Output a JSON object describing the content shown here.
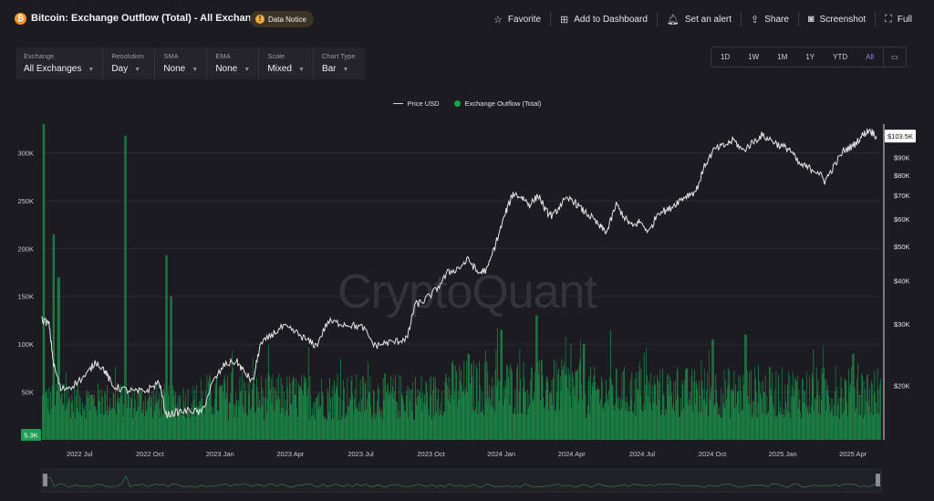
{
  "header": {
    "coin_symbol": "₿",
    "title": "Bitcoin: Exchange Outflow (Total) - All Exchanges",
    "notice_icon": "!",
    "notice_label": "Data Notice"
  },
  "actions": [
    {
      "icon": "star-icon",
      "glyph": "☆",
      "label": "Favorite"
    },
    {
      "icon": "dashboard-add-icon",
      "glyph": "⊞",
      "label": "Add to Dashboard"
    },
    {
      "icon": "bell-icon",
      "glyph": "🔔︎",
      "label": "Set an alert"
    },
    {
      "icon": "share-icon",
      "glyph": "⇪",
      "label": "Share"
    },
    {
      "icon": "camera-icon",
      "glyph": "◙",
      "label": "Screenshot"
    },
    {
      "icon": "fullscreen-icon",
      "glyph": "⛶",
      "label": "Full"
    }
  ],
  "controls": [
    {
      "label": "Exchange",
      "value": "All Exchanges"
    },
    {
      "label": "Resolution",
      "value": "Day"
    },
    {
      "label": "SMA",
      "value": "None"
    },
    {
      "label": "EMA",
      "value": "None"
    },
    {
      "label": "Scale",
      "value": "Mixed"
    },
    {
      "label": "Chart Type",
      "value": "Bar"
    }
  ],
  "ranges": [
    "1D",
    "1W",
    "1M",
    "1Y",
    "YTD",
    "All"
  ],
  "active_range": "All",
  "watermark": "CryptoQuant",
  "chart_data": {
    "type": "bar",
    "legend": [
      "Price USD",
      "Exchange Outflow (Total)"
    ],
    "colors": {
      "price": "#e6e6e6",
      "outflow": "#17a34a",
      "outflow_fill": "#1f8a4c",
      "price_badge": "#ffffff",
      "outflow_badge": "#1f9d55"
    },
    "x_tick_labels": [
      "2022 Jul",
      "2022 Oct",
      "2023 Jan",
      "2023 Apr",
      "2023 Jul",
      "2023 Oct",
      "2024 Jan",
      "2024 Apr",
      "2024 Jul",
      "2024 Oct",
      "2025 Jan",
      "2025 Apr"
    ],
    "x_range_months": [
      0,
      35.8
    ],
    "x_tick_months": [
      1.6,
      4.6,
      7.6,
      10.6,
      13.6,
      16.6,
      19.6,
      22.6,
      25.6,
      28.6,
      31.6,
      34.6
    ],
    "left_axis": {
      "label": "Exchange Outflow",
      "ticks": [
        "50K",
        "100K",
        "150K",
        "200K",
        "250K",
        "300K"
      ],
      "tick_values": [
        50000,
        100000,
        150000,
        200000,
        250000,
        300000
      ],
      "range": [
        0,
        330000
      ]
    },
    "right_axis": {
      "label": "Price USD",
      "scale": "log",
      "ticks": [
        "$20K",
        "$30K",
        "$40K",
        "$50K",
        "$60K",
        "$70K",
        "$80K",
        "$90K"
      ],
      "tick_values": [
        20000,
        30000,
        40000,
        50000,
        60000,
        70000,
        80000,
        90000
      ],
      "range": [
        14000,
        112000
      ]
    },
    "last_price_label": "$103.5K",
    "last_outflow_label": "5.3K",
    "outflow_spikes": [
      {
        "month": 0.05,
        "value": 330000
      },
      {
        "month": 0.5,
        "value": 215000
      },
      {
        "month": 0.7,
        "value": 170000
      },
      {
        "month": 3.55,
        "value": 318000
      },
      {
        "month": 5.3,
        "value": 193000
      },
      {
        "month": 5.5,
        "value": 150000
      },
      {
        "month": 18.2,
        "value": 90000
      },
      {
        "month": 19.6,
        "value": 115000
      },
      {
        "month": 21.1,
        "value": 130000
      },
      {
        "month": 23.1,
        "value": 100000
      },
      {
        "month": 28.6,
        "value": 105000
      },
      {
        "month": 30.0,
        "value": 110000
      },
      {
        "month": 34.6,
        "value": 90000
      }
    ],
    "price_series": [
      {
        "month": 0.0,
        "price": 31000
      },
      {
        "month": 0.3,
        "price": 30000
      },
      {
        "month": 0.5,
        "price": 23000
      },
      {
        "month": 0.8,
        "price": 19500
      },
      {
        "month": 1.3,
        "price": 20000
      },
      {
        "month": 1.9,
        "price": 21500
      },
      {
        "month": 2.3,
        "price": 23500
      },
      {
        "month": 2.7,
        "price": 22000
      },
      {
        "month": 3.0,
        "price": 20000
      },
      {
        "month": 3.5,
        "price": 19500
      },
      {
        "month": 4.0,
        "price": 19200
      },
      {
        "month": 4.5,
        "price": 19400
      },
      {
        "month": 5.0,
        "price": 20500
      },
      {
        "month": 5.3,
        "price": 16500
      },
      {
        "month": 5.8,
        "price": 16800
      },
      {
        "month": 6.4,
        "price": 17000
      },
      {
        "month": 6.8,
        "price": 16700
      },
      {
        "month": 7.3,
        "price": 20500
      },
      {
        "month": 7.8,
        "price": 23000
      },
      {
        "month": 8.3,
        "price": 23500
      },
      {
        "month": 8.6,
        "price": 22000
      },
      {
        "month": 9.0,
        "price": 20500
      },
      {
        "month": 9.3,
        "price": 26000
      },
      {
        "month": 9.8,
        "price": 28000
      },
      {
        "month": 10.3,
        "price": 29500
      },
      {
        "month": 10.8,
        "price": 28500
      },
      {
        "month": 11.3,
        "price": 27000
      },
      {
        "month": 11.7,
        "price": 26000
      },
      {
        "month": 12.2,
        "price": 30500
      },
      {
        "month": 12.7,
        "price": 30200
      },
      {
        "month": 13.2,
        "price": 29800
      },
      {
        "month": 13.7,
        "price": 29300
      },
      {
        "month": 14.2,
        "price": 26000
      },
      {
        "month": 14.7,
        "price": 26500
      },
      {
        "month": 15.2,
        "price": 26800
      },
      {
        "month": 15.6,
        "price": 27500
      },
      {
        "month": 15.9,
        "price": 34000
      },
      {
        "month": 16.3,
        "price": 35000
      },
      {
        "month": 16.8,
        "price": 37500
      },
      {
        "month": 17.3,
        "price": 42000
      },
      {
        "month": 17.8,
        "price": 43500
      },
      {
        "month": 18.2,
        "price": 46000
      },
      {
        "month": 18.6,
        "price": 42000
      },
      {
        "month": 19.0,
        "price": 43000
      },
      {
        "month": 19.4,
        "price": 52000
      },
      {
        "month": 19.8,
        "price": 63000
      },
      {
        "month": 20.1,
        "price": 71000
      },
      {
        "month": 20.5,
        "price": 69000
      },
      {
        "month": 20.8,
        "price": 66000
      },
      {
        "month": 21.2,
        "price": 70000
      },
      {
        "month": 21.5,
        "price": 63000
      },
      {
        "month": 21.8,
        "price": 61000
      },
      {
        "month": 22.2,
        "price": 67000
      },
      {
        "month": 22.6,
        "price": 68500
      },
      {
        "month": 23.0,
        "price": 64000
      },
      {
        "month": 23.4,
        "price": 61000
      },
      {
        "month": 23.8,
        "price": 57000
      },
      {
        "month": 24.1,
        "price": 55000
      },
      {
        "month": 24.5,
        "price": 66000
      },
      {
        "month": 24.9,
        "price": 60000
      },
      {
        "month": 25.2,
        "price": 57000
      },
      {
        "month": 25.5,
        "price": 59000
      },
      {
        "month": 25.9,
        "price": 55000
      },
      {
        "month": 26.3,
        "price": 63000
      },
      {
        "month": 26.7,
        "price": 63500
      },
      {
        "month": 27.1,
        "price": 67000
      },
      {
        "month": 27.5,
        "price": 70000
      },
      {
        "month": 27.9,
        "price": 72000
      },
      {
        "month": 28.3,
        "price": 86000
      },
      {
        "month": 28.7,
        "price": 95000
      },
      {
        "month": 29.1,
        "price": 97000
      },
      {
        "month": 29.5,
        "price": 101000
      },
      {
        "month": 29.9,
        "price": 94000
      },
      {
        "month": 30.3,
        "price": 99000
      },
      {
        "month": 30.7,
        "price": 104000
      },
      {
        "month": 31.1,
        "price": 101000
      },
      {
        "month": 31.5,
        "price": 97000
      },
      {
        "month": 31.9,
        "price": 95000
      },
      {
        "month": 32.3,
        "price": 86000
      },
      {
        "month": 32.7,
        "price": 84000
      },
      {
        "month": 33.1,
        "price": 82000
      },
      {
        "month": 33.4,
        "price": 77000
      },
      {
        "month": 33.8,
        "price": 85000
      },
      {
        "month": 34.2,
        "price": 94000
      },
      {
        "month": 34.6,
        "price": 97000
      },
      {
        "month": 35.0,
        "price": 104000
      },
      {
        "month": 35.3,
        "price": 108000
      },
      {
        "month": 35.6,
        "price": 103500
      }
    ]
  }
}
